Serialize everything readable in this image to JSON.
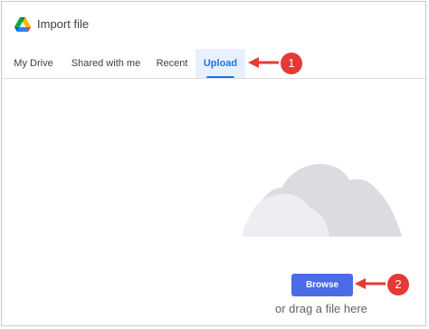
{
  "header": {
    "title": "Import file",
    "logo": "google-drive-logo"
  },
  "tabs": [
    {
      "label": "My Drive"
    },
    {
      "label": "Shared with me"
    },
    {
      "label": "Recent"
    },
    {
      "label": "Upload",
      "active": true
    }
  ],
  "upload": {
    "browse_label": "Browse",
    "drag_text": "or drag a file here",
    "illustration": "cloud-icon"
  },
  "annotations": [
    {
      "label": "1"
    },
    {
      "label": "2"
    }
  ],
  "colors": {
    "accent": "#1a73e8",
    "browse_button": "#4a6de5",
    "active_tab_bg": "#e8f0fe",
    "callout": "#e53935"
  }
}
